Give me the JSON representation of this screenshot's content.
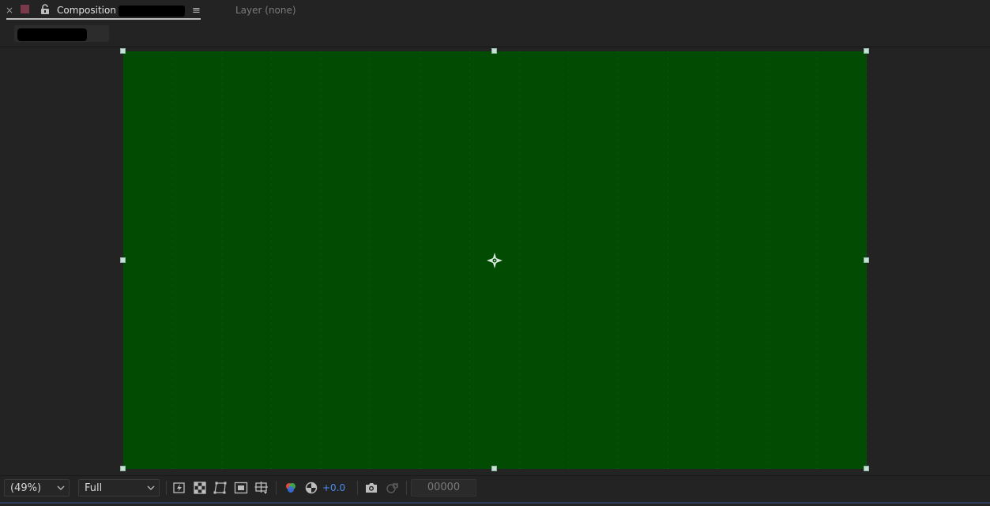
{
  "panel": {
    "close_glyph": "×",
    "composition_label": "Composition",
    "menu_glyph": "≡",
    "layer_label": "Layer (none)",
    "composition_color": "#7b3a4c"
  },
  "canvas": {
    "background_color": "#024b02",
    "grid": true,
    "anchor_icon": "anchor-point-icon"
  },
  "toolbar": {
    "magnification": "(49%)",
    "resolution": "Full",
    "icons": [
      "fast-previews-icon",
      "transparency-grid-icon",
      "mask-path-icon",
      "region-of-interest-icon",
      "guides-grid-icon",
      "color-channels-icon",
      "reset-exposure-icon",
      "snapshot-icon",
      "show-snapshot-icon"
    ],
    "exposure": "+0.0",
    "timecode": "00000",
    "accent_color": "#4a8ef0"
  }
}
